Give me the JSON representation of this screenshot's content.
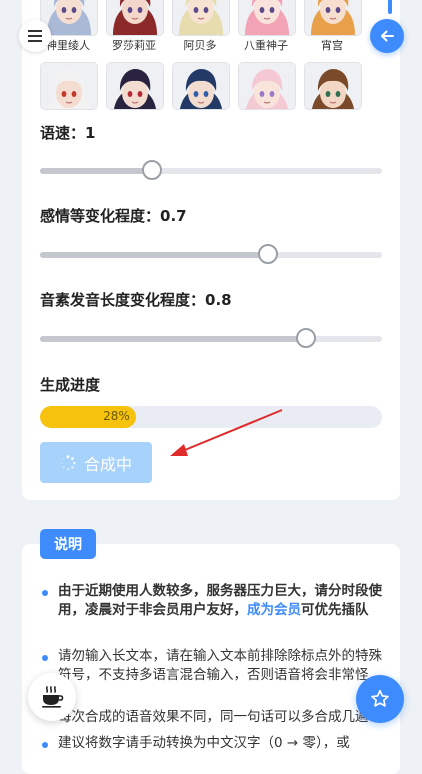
{
  "characters_row1": [
    {
      "name": "神里绫人",
      "hair": "#a9b9d6",
      "skin": "#f5dfd3"
    },
    {
      "name": "罗莎莉亚",
      "hair": "#8c2a2a",
      "skin": "#f3d7cb"
    },
    {
      "name": "阿贝多",
      "hair": "#e7dcae",
      "skin": "#f6e3d2"
    },
    {
      "name": "八重神子",
      "hair": "#f2a3b6",
      "skin": "#f9e3dc"
    },
    {
      "name": "宵宫",
      "hair": "#e8a04a",
      "skin": "#f6dfcf"
    }
  ],
  "characters_row2": [
    {
      "hair": "#f2f2f2",
      "skin": "#f4ddd0",
      "accent": "#c0392b"
    },
    {
      "hair": "#2a2340",
      "skin": "#f3dcd0",
      "accent": "#b52a3b"
    },
    {
      "hair": "#233a66",
      "skin": "#f2dcd0",
      "accent": "#2f5fa8"
    },
    {
      "hair": "#f5c9d4",
      "skin": "#f9e4dc",
      "accent": "#9a79c9"
    },
    {
      "hair": "#7a4a2a",
      "skin": "#f2d7c4",
      "accent": "#2f6e4f"
    }
  ],
  "controls": {
    "speed_label": "语速：1",
    "speed_value": 1,
    "speed_fraction": 0.33,
    "emotion_label": "感情等变化程度：0.7",
    "emotion_value": 0.7,
    "emotion_fraction": 0.67,
    "phoneme_label": "音素发音长度变化程度：0.8",
    "phoneme_value": 0.8,
    "phoneme_fraction": 0.78
  },
  "progress": {
    "label": "生成进度",
    "percent_text": "28%",
    "percent": 28
  },
  "generate_button": {
    "label": "合成中"
  },
  "info": {
    "tag": "说明",
    "note1_a": "由于近期使用人数较多，服务器压力巨大，请分时段使用，凌晨对于非会员用户友好，",
    "note1_vip": "成为会员",
    "note1_b": "可优先插队",
    "note2": "请勿输入长文本，请在输入文本前排除除标点外的特殊符号，不支持多语言混合输入，否则语音将会非常怪",
    "note3": "每次合成的语音效果不同，同一句话可以多合成几遍",
    "note4": "建议将数字请手动转换为中文汉字（0 → 零），或"
  },
  "colors": {
    "accent": "#3d8bfd",
    "progress": "#f7c20e",
    "button_disabled": "#a7d2fb"
  },
  "icons": {
    "menu": "menu-icon",
    "back": "arrow-left-icon",
    "spinner": "spinner-icon",
    "coffee": "coffee-icon",
    "star": "star-icon"
  }
}
